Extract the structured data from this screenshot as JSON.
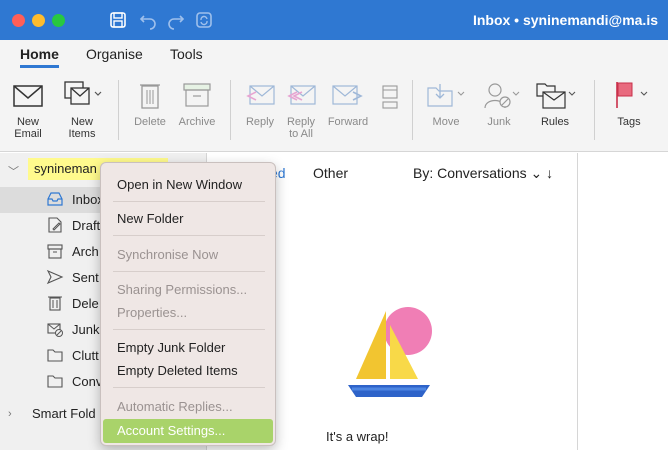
{
  "window": {
    "title": "Inbox • syninemandi@ma.is"
  },
  "ribbon": {
    "tabs": [
      {
        "label": "Home"
      },
      {
        "label": "Organise"
      },
      {
        "label": "Tools"
      }
    ],
    "new_email": {
      "line1": "New",
      "line2": "Email"
    },
    "new_items": {
      "line1": "New",
      "line2": "Items"
    },
    "delete": "Delete",
    "archive": "Archive",
    "reply": "Reply",
    "reply_all": {
      "line1": "Reply",
      "line2": "to All"
    },
    "forward": "Forward",
    "move": "Move",
    "junk": "Junk",
    "rules": "Rules",
    "tags": "Tags"
  },
  "sidebar": {
    "account": "synineman",
    "folders": [
      {
        "label": "Inbox",
        "icon": "inbox-icon"
      },
      {
        "label": "Draft",
        "icon": "draft-icon"
      },
      {
        "label": "Arch",
        "icon": "archive-icon"
      },
      {
        "label": "Sent",
        "icon": "sent-icon"
      },
      {
        "label": "Dele",
        "icon": "trash-icon"
      },
      {
        "label": "Junk",
        "icon": "junk-icon"
      },
      {
        "label": "Clutt",
        "icon": "folder-icon"
      },
      {
        "label": "Conv",
        "icon": "folder-icon"
      }
    ],
    "smart_folders": "Smart Fold"
  },
  "message_list": {
    "focused_tab": "ed",
    "other_tab": "Other",
    "sort": "By: Conversations",
    "empty_text": "It's a wrap!"
  },
  "context_menu": {
    "open_new_window": "Open in New Window",
    "new_folder": "New Folder",
    "synchronise": "Synchronise Now",
    "sharing": "Sharing Permissions...",
    "properties": "Properties...",
    "empty_junk": "Empty Junk Folder",
    "empty_deleted": "Empty Deleted Items",
    "auto_replies": "Automatic Replies...",
    "account_settings": "Account Settings..."
  },
  "colors": {
    "titlebar": "#2F78D2",
    "menu_highlight": "#A9D36A",
    "account_highlight": "#FFFA8D"
  }
}
